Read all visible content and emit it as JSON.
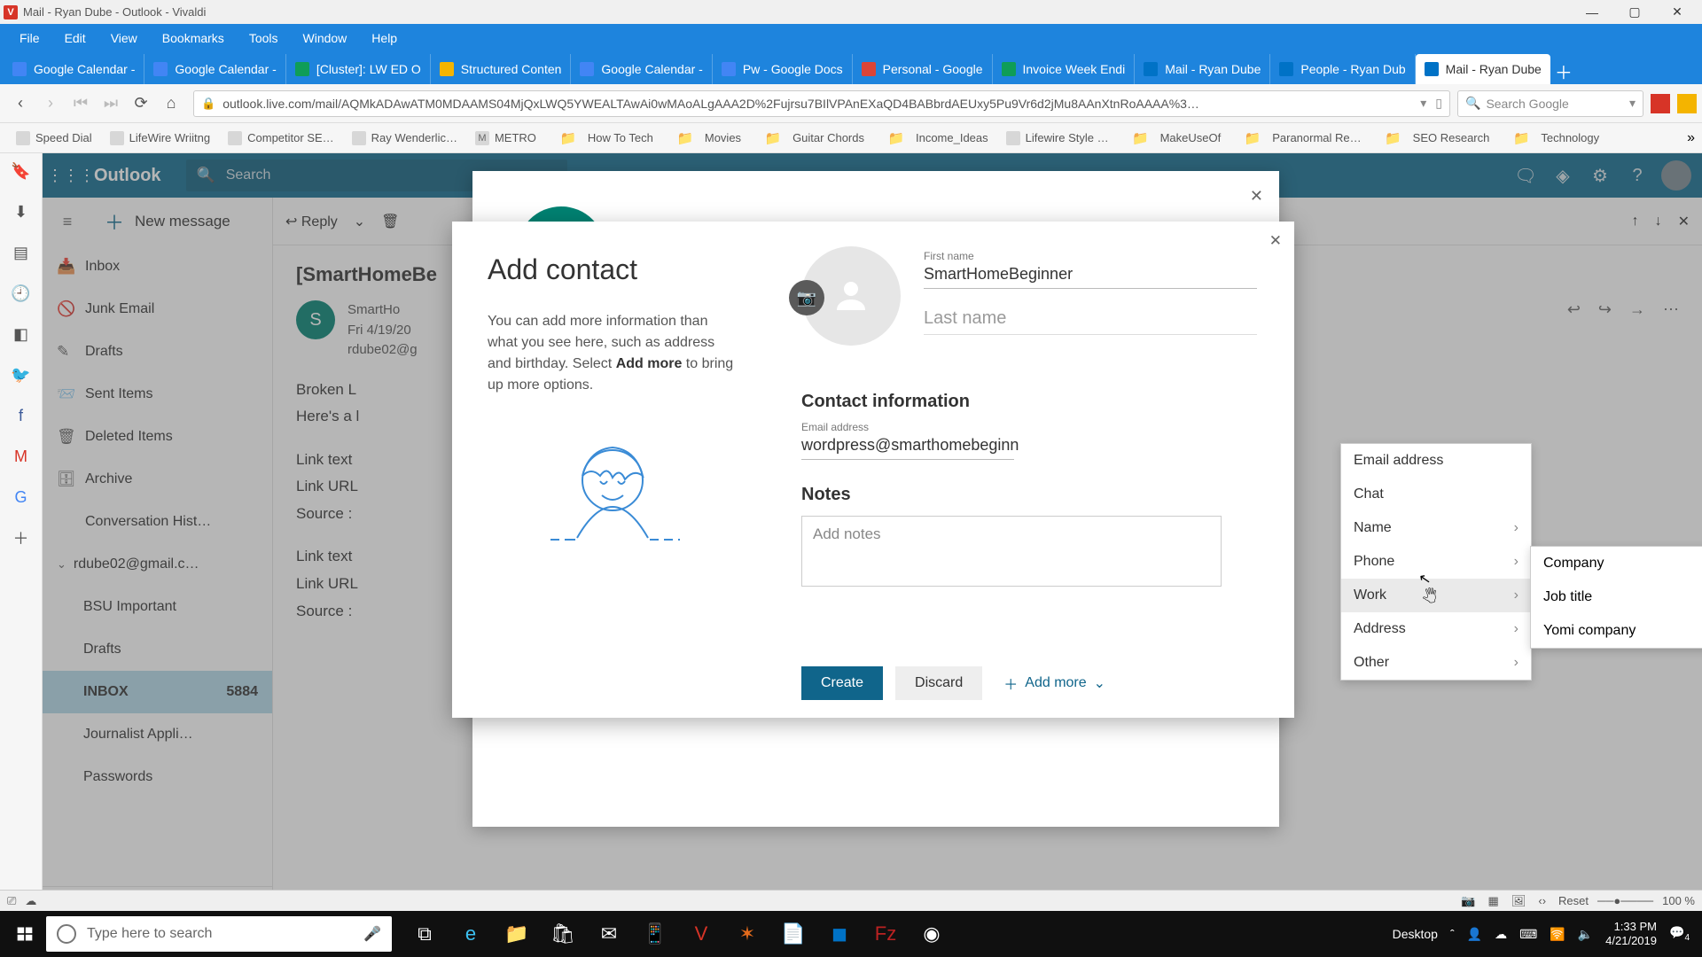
{
  "window": {
    "title": "Mail - Ryan Dube - Outlook - Vivaldi"
  },
  "menubar": [
    "File",
    "Edit",
    "View",
    "Bookmarks",
    "Tools",
    "Window",
    "Help"
  ],
  "tabs": [
    {
      "label": "Google Calendar -",
      "color": "#4285f4"
    },
    {
      "label": "Google Calendar -",
      "color": "#4285f4"
    },
    {
      "label": "[Cluster]: LW ED O",
      "color": "#0f9d58"
    },
    {
      "label": "Structured Conten",
      "color": "#f4b400"
    },
    {
      "label": "Google Calendar -",
      "color": "#4285f4"
    },
    {
      "label": "Pw - Google Docs",
      "color": "#4285f4"
    },
    {
      "label": "Personal - Google",
      "color": "#db4437"
    },
    {
      "label": "Invoice Week Endi",
      "color": "#0f9d58"
    },
    {
      "label": "Mail - Ryan Dube",
      "color": "#0072c6"
    },
    {
      "label": "People - Ryan Dub",
      "color": "#0072c6"
    },
    {
      "label": "Mail - Ryan Dube",
      "color": "#0072c6",
      "active": true
    }
  ],
  "address": {
    "url": "outlook.live.com/mail/AQMkADAwATM0MDAAMS04MjQxLWQ5YWEALTAwAi0wMAoALgAAA2D%2Fujrsu7BIlVPAnEXaQD4BABbrdAEUxy5Pu9Vr6d2jMu8AAnXtnRoAAAA%3…",
    "search_placeholder": "Search Google"
  },
  "bookmarks": [
    {
      "label": "Speed Dial",
      "kind": "sd"
    },
    {
      "label": "LifeWire Wriitng",
      "kind": "sd"
    },
    {
      "label": "Competitor SE…",
      "kind": "chart"
    },
    {
      "label": "Ray Wenderlic…",
      "kind": "site"
    },
    {
      "label": "METRO",
      "kind": "m"
    },
    {
      "label": "How To Tech",
      "kind": "folder"
    },
    {
      "label": "Movies",
      "kind": "folder"
    },
    {
      "label": "Guitar Chords",
      "kind": "folder"
    },
    {
      "label": "Income_Ideas",
      "kind": "folder"
    },
    {
      "label": "Lifewire Style …",
      "kind": "doc"
    },
    {
      "label": "MakeUseOf",
      "kind": "folder"
    },
    {
      "label": "Paranormal Re…",
      "kind": "folder"
    },
    {
      "label": "SEO Research",
      "kind": "folder"
    },
    {
      "label": "Technology",
      "kind": "folder"
    }
  ],
  "panel_icons": [
    "bookmark",
    "download",
    "notes",
    "clock",
    "window",
    "twitter",
    "facebook",
    "gmail",
    "google",
    "plus"
  ],
  "outlook": {
    "brand": "Outlook",
    "search_placeholder": "Search",
    "new_message": "New message",
    "toolbar": {
      "reply": "Reply"
    },
    "folders_top": [
      {
        "icon": "inbox",
        "label": "Inbox"
      },
      {
        "icon": "junk",
        "label": "Junk Email"
      },
      {
        "icon": "drafts",
        "label": "Drafts"
      },
      {
        "icon": "sent",
        "label": "Sent Items"
      },
      {
        "icon": "deleted",
        "label": "Deleted Items"
      },
      {
        "icon": "archive",
        "label": "Archive"
      },
      {
        "icon": "",
        "label": "Conversation Hist…"
      }
    ],
    "account": "rdube02@gmail.c…",
    "folders_child": [
      {
        "label": "BSU Important"
      },
      {
        "label": "Drafts"
      },
      {
        "label": "INBOX",
        "badge": "5884",
        "active": true
      },
      {
        "label": "Journalist Appli…"
      },
      {
        "label": "Passwords"
      }
    ],
    "message": {
      "subject": "[SmartHomeBe",
      "avatar_letter": "S",
      "sender": "SmartHo",
      "date": "Fri 4/19/20",
      "to": "rdube02@g",
      "body": [
        "Broken L",
        "Here's a l",
        "Link text",
        "Link URL",
        "Source :",
        "Link text",
        "Link URL",
        "Source :"
      ]
    }
  },
  "dialog": {
    "title": "Add contact",
    "description_pre": "You can add more information than what you see here, such as address and birthday. Select ",
    "description_bold": "Add more",
    "description_post": " to bring up more options.",
    "first_name_label": "First name",
    "first_name_value": "SmartHomeBeginner",
    "last_name_placeholder": "Last name",
    "section_contact": "Contact information",
    "email_label": "Email address",
    "email_value": "wordpress@smarthomebeginn",
    "section_notes": "Notes",
    "notes_placeholder": "Add notes",
    "btn_create": "Create",
    "btn_discard": "Discard",
    "add_more": "Add more"
  },
  "dropdown": {
    "items": [
      {
        "label": "Email address"
      },
      {
        "label": "Chat"
      },
      {
        "label": "Name",
        "sub": true
      },
      {
        "label": "Phone",
        "sub": true
      },
      {
        "label": "Work",
        "sub": true,
        "hover": true
      },
      {
        "label": "Address",
        "sub": true
      },
      {
        "label": "Other",
        "sub": true
      }
    ],
    "submenu": [
      "Company",
      "Job title",
      "Yomi company"
    ]
  },
  "statusbar": {
    "reset": "Reset",
    "zoom": "100 %"
  },
  "taskbar": {
    "search_placeholder": "Type here to search",
    "desktop": "Desktop",
    "time": "1:33 PM",
    "date": "4/21/2019",
    "notif": "4"
  }
}
